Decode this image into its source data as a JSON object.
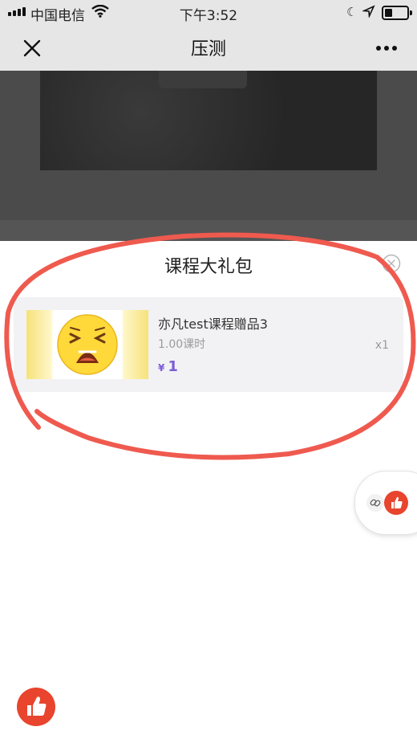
{
  "status_bar": {
    "carrier": "中国电信",
    "time": "下午3:52"
  },
  "nav": {
    "title": "压测"
  },
  "sheet": {
    "title": "课程大礼包",
    "item": {
      "name": "亦凡test课程赠品3",
      "hours": "1.00课时",
      "currency": "¥",
      "price": "1",
      "quantity": "x1"
    }
  },
  "colors": {
    "accent_price": "#7a5cd6",
    "like_red": "#e8442e",
    "annotation_red": "#ef5a4f"
  },
  "icons": {
    "close": "close-icon",
    "more": "more-dots-icon",
    "sheet_close": "circle-close-icon",
    "emoji": "crying-emoji-icon",
    "link": "link-icon",
    "thumbs_up": "thumbs-up-icon"
  }
}
